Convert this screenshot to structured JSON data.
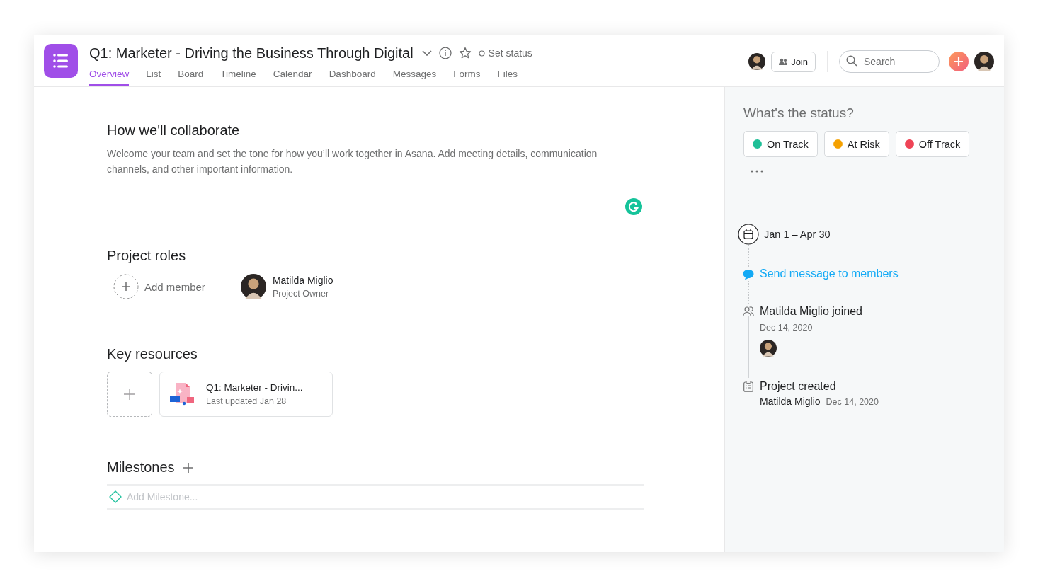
{
  "header": {
    "title": "Q1: Marketer - Driving the Business Through Digital",
    "set_status": "Set status",
    "join": "Join",
    "search": {
      "placeholder": "Search"
    },
    "tabs": [
      {
        "label": "Overview",
        "selected": true
      },
      {
        "label": "List",
        "selected": false
      },
      {
        "label": "Board",
        "selected": false
      },
      {
        "label": "Timeline",
        "selected": false
      },
      {
        "label": "Calendar",
        "selected": false
      },
      {
        "label": "Dashboard",
        "selected": false
      },
      {
        "label": "Messages",
        "selected": false
      },
      {
        "label": "Forms",
        "selected": false
      },
      {
        "label": "Files",
        "selected": false
      }
    ]
  },
  "overview": {
    "collab_title": "How we'll collaborate",
    "collab_text": "Welcome your team and set the tone for how you’ll work together in Asana. Add meeting details, communication channels, and other important information.",
    "roles_title": "Project roles",
    "add_member": "Add member",
    "members": [
      {
        "name": "Matilda Miglio",
        "role": "Project Owner"
      }
    ],
    "resources_title": "Key resources",
    "resources": [
      {
        "title": "Q1: Marketer - Drivin...",
        "updated": "Last updated Jan 28"
      }
    ],
    "milestones_title": "Milestones",
    "milestone_placeholder": "Add Milestone..."
  },
  "status_panel": {
    "title": "What's the status?",
    "options": [
      {
        "label": "On Track",
        "color": "#1fbf97"
      },
      {
        "label": "At Risk",
        "color": "#f5a100"
      },
      {
        "label": "Off Track",
        "color": "#ef4456"
      }
    ],
    "timeline": [
      {
        "kind": "date",
        "text": "Jan 1 – Apr 30"
      },
      {
        "kind": "link",
        "text": "Send message to members"
      },
      {
        "kind": "joined",
        "text": "Matilda Miglio joined",
        "date": "Dec 14, 2020"
      },
      {
        "kind": "created",
        "text": "Project created",
        "author": "Matilda Miglio",
        "date": "Dec 14, 2020"
      }
    ]
  }
}
